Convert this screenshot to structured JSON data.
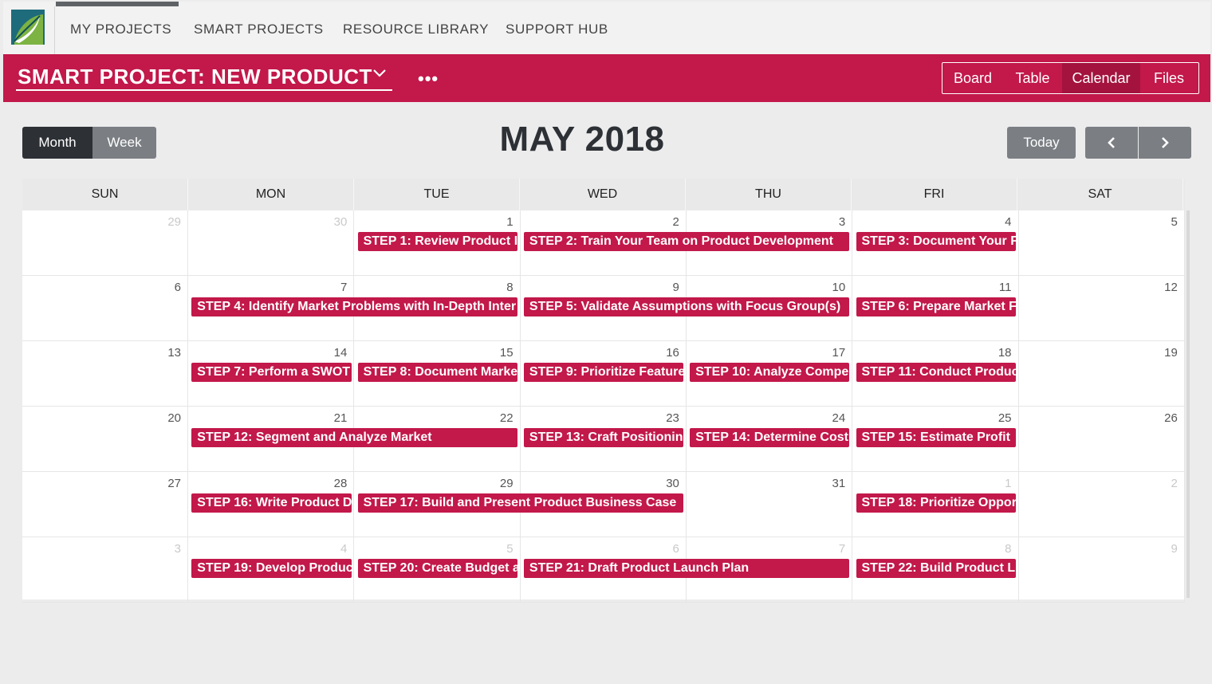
{
  "nav": {
    "items": [
      "MY PROJECTS",
      "SMART PROJECTS",
      "RESOURCE LIBRARY",
      "SUPPORT HUB"
    ]
  },
  "project": {
    "title": "SMART PROJECT: NEW PRODUCT",
    "more": "•••",
    "views": [
      "Board",
      "Table",
      "Calendar",
      "Files"
    ],
    "active_view": "Calendar"
  },
  "calendar": {
    "toggle": {
      "month": "Month",
      "week": "Week",
      "active": "Month"
    },
    "title": "MAY 2018",
    "today_label": "Today",
    "days_of_week": [
      "SUN",
      "MON",
      "TUE",
      "WED",
      "THU",
      "FRI",
      "SAT"
    ],
    "weeks": [
      [
        {
          "n": "29",
          "other": true
        },
        {
          "n": "30",
          "other": true
        },
        {
          "n": "1"
        },
        {
          "n": "2"
        },
        {
          "n": "3"
        },
        {
          "n": "4"
        },
        {
          "n": "5"
        }
      ],
      [
        {
          "n": "6"
        },
        {
          "n": "7"
        },
        {
          "n": "8"
        },
        {
          "n": "9"
        },
        {
          "n": "10"
        },
        {
          "n": "11"
        },
        {
          "n": "12"
        }
      ],
      [
        {
          "n": "13"
        },
        {
          "n": "14"
        },
        {
          "n": "15"
        },
        {
          "n": "16"
        },
        {
          "n": "17"
        },
        {
          "n": "18"
        },
        {
          "n": "19"
        }
      ],
      [
        {
          "n": "20"
        },
        {
          "n": "21"
        },
        {
          "n": "22"
        },
        {
          "n": "23"
        },
        {
          "n": "24"
        },
        {
          "n": "25"
        },
        {
          "n": "26"
        }
      ],
      [
        {
          "n": "27"
        },
        {
          "n": "28"
        },
        {
          "n": "29"
        },
        {
          "n": "30"
        },
        {
          "n": "31"
        },
        {
          "n": "1",
          "other": true
        },
        {
          "n": "2",
          "other": true
        }
      ],
      [
        {
          "n": "3",
          "other": true
        },
        {
          "n": "4",
          "other": true
        },
        {
          "n": "5",
          "other": true
        },
        {
          "n": "6",
          "other": true
        },
        {
          "n": "7",
          "other": true
        },
        {
          "n": "8",
          "other": true
        },
        {
          "n": "9",
          "other": true
        }
      ]
    ],
    "events": [
      {
        "week": 0,
        "start": 2,
        "span": 1,
        "label": "STEP 1: Review Product I"
      },
      {
        "week": 0,
        "start": 3,
        "span": 2,
        "label": "STEP 2: Train Your Team on Product Development"
      },
      {
        "week": 0,
        "start": 5,
        "span": 1,
        "label": "STEP 3: Document Your F"
      },
      {
        "week": 1,
        "start": 1,
        "span": 2,
        "label": "STEP 4: Identify Market Problems with In-Depth Inter"
      },
      {
        "week": 1,
        "start": 3,
        "span": 2,
        "label": "STEP 5: Validate Assumptions with Focus Group(s)"
      },
      {
        "week": 1,
        "start": 5,
        "span": 1,
        "label": "STEP 6: Prepare Market F"
      },
      {
        "week": 2,
        "start": 1,
        "span": 1,
        "label": "STEP 7: Perform a SWOT"
      },
      {
        "week": 2,
        "start": 2,
        "span": 1,
        "label": "STEP 8: Document Marke"
      },
      {
        "week": 2,
        "start": 3,
        "span": 1,
        "label": "STEP 9: Prioritize Feature"
      },
      {
        "week": 2,
        "start": 4,
        "span": 1,
        "label": "STEP 10: Analyze Compe"
      },
      {
        "week": 2,
        "start": 5,
        "span": 1,
        "label": "STEP 11: Conduct Produc"
      },
      {
        "week": 3,
        "start": 1,
        "span": 2,
        "label": "STEP 12: Segment and Analyze Market"
      },
      {
        "week": 3,
        "start": 3,
        "span": 1,
        "label": "STEP 13: Craft Positionin"
      },
      {
        "week": 3,
        "start": 4,
        "span": 1,
        "label": "STEP 14: Determine Cost"
      },
      {
        "week": 3,
        "start": 5,
        "span": 1,
        "label": "STEP 15: Estimate Profit"
      },
      {
        "week": 4,
        "start": 1,
        "span": 1,
        "label": "STEP 16: Write Product D"
      },
      {
        "week": 4,
        "start": 2,
        "span": 2,
        "label": "STEP 17: Build and Present Product Business Case"
      },
      {
        "week": 4,
        "start": 5,
        "span": 1,
        "label": "STEP 18: Prioritize Oppor"
      },
      {
        "week": 5,
        "start": 1,
        "span": 1,
        "label": "STEP 19: Develop Produc"
      },
      {
        "week": 5,
        "start": 2,
        "span": 1,
        "label": "STEP 20: Create Budget a"
      },
      {
        "week": 5,
        "start": 3,
        "span": 2,
        "label": "STEP 21: Draft Product Launch Plan"
      },
      {
        "week": 5,
        "start": 5,
        "span": 1,
        "label": "STEP 22: Build Product L"
      }
    ]
  },
  "colors": {
    "accent": "#c2184a",
    "dark_button": "#2d3136",
    "gray_button": "#7b7f84"
  }
}
